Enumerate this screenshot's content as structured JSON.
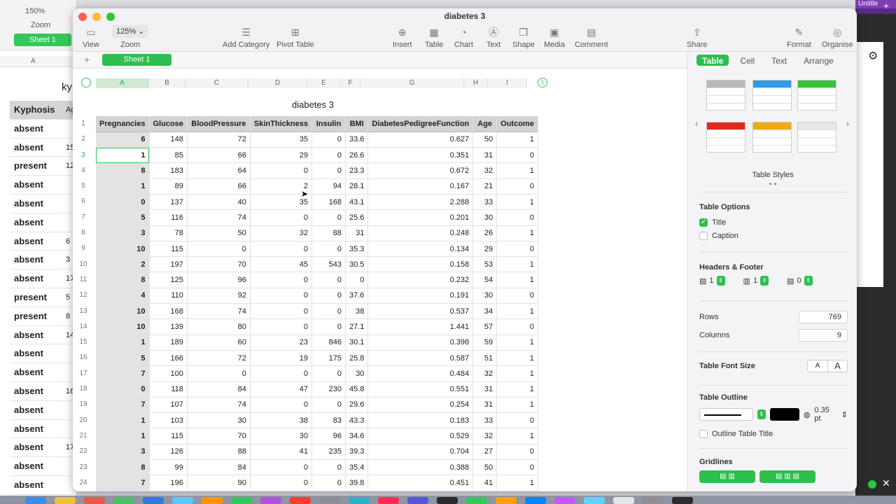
{
  "background_window": {
    "zoom": "150%",
    "zoom_label": "Zoom",
    "sheet_tab": "Sheet 1",
    "col_letter": "A",
    "title_fragment": "ky",
    "rows": [
      {
        "v": "Kyphosis",
        "f": "Ag"
      },
      {
        "v": "absent",
        "f": ""
      },
      {
        "v": "absent",
        "f": "15"
      },
      {
        "v": "present",
        "f": "12"
      },
      {
        "v": "absent",
        "f": ""
      },
      {
        "v": "absent",
        "f": ""
      },
      {
        "v": "absent",
        "f": ""
      },
      {
        "v": "absent",
        "f": "6"
      },
      {
        "v": "absent",
        "f": "3"
      },
      {
        "v": "absent",
        "f": "17"
      },
      {
        "v": "present",
        "f": "5"
      },
      {
        "v": "present",
        "f": "8"
      },
      {
        "v": "absent",
        "f": "14"
      },
      {
        "v": "absent",
        "f": ""
      },
      {
        "v": "absent",
        "f": ""
      },
      {
        "v": "absent",
        "f": "16"
      },
      {
        "v": "absent",
        "f": ""
      },
      {
        "v": "absent",
        "f": ""
      },
      {
        "v": "absent",
        "f": "17"
      },
      {
        "v": "absent",
        "f": ""
      },
      {
        "v": "absent",
        "f": ""
      }
    ]
  },
  "right_strip": {
    "tab_title": "Untitle"
  },
  "window": {
    "title": "diabetes 3"
  },
  "toolbar": {
    "view": "View",
    "zoom_value": "125%",
    "zoom": "Zoom",
    "add_category": "Add Category",
    "pivot_table": "Pivot Table",
    "insert": "Insert",
    "table": "Table",
    "chart": "Chart",
    "text": "Text",
    "shape": "Shape",
    "media": "Media",
    "comment": "Comment",
    "share": "Share",
    "format": "Format",
    "organise": "Organise"
  },
  "sheet_tab": "Sheet 1",
  "column_letters": [
    "A",
    "B",
    "C",
    "D",
    "E",
    "F",
    "G",
    "H",
    "I"
  ],
  "table": {
    "title": "diabetes 3",
    "headers": [
      "Pregnancies",
      "Glucose",
      "BloodPressure",
      "SkinThickness",
      "Insulin",
      "BMI",
      "DiabetesPedigreeFunction",
      "Age",
      "Outcome"
    ],
    "row_numbers": [
      "1",
      "2",
      "3",
      "4",
      "5",
      "6",
      "7",
      "8",
      "9",
      "10",
      "11",
      "12",
      "13",
      "14",
      "15",
      "16",
      "17",
      "18",
      "19",
      "20",
      "21",
      "22",
      "23",
      "24"
    ],
    "rows": [
      [
        "6",
        "148",
        "72",
        "35",
        "0",
        "33.6",
        "0.627",
        "50",
        "1"
      ],
      [
        "1",
        "85",
        "66",
        "29",
        "0",
        "26.6",
        "0.351",
        "31",
        "0"
      ],
      [
        "8",
        "183",
        "64",
        "0",
        "0",
        "23.3",
        "0.672",
        "32",
        "1"
      ],
      [
        "1",
        "89",
        "66",
        "2",
        "94",
        "28.1",
        "0.167",
        "21",
        "0"
      ],
      [
        "0",
        "137",
        "40",
        "35",
        "168",
        "43.1",
        "2.288",
        "33",
        "1"
      ],
      [
        "5",
        "116",
        "74",
        "0",
        "0",
        "25.6",
        "0.201",
        "30",
        "0"
      ],
      [
        "3",
        "78",
        "50",
        "32",
        "88",
        "31",
        "0.248",
        "26",
        "1"
      ],
      [
        "10",
        "115",
        "0",
        "0",
        "0",
        "35.3",
        "0.134",
        "29",
        "0"
      ],
      [
        "2",
        "197",
        "70",
        "45",
        "543",
        "30.5",
        "0.158",
        "53",
        "1"
      ],
      [
        "8",
        "125",
        "96",
        "0",
        "0",
        "0",
        "0.232",
        "54",
        "1"
      ],
      [
        "4",
        "110",
        "92",
        "0",
        "0",
        "37.6",
        "0.191",
        "30",
        "0"
      ],
      [
        "10",
        "168",
        "74",
        "0",
        "0",
        "38",
        "0.537",
        "34",
        "1"
      ],
      [
        "10",
        "139",
        "80",
        "0",
        "0",
        "27.1",
        "1.441",
        "57",
        "0"
      ],
      [
        "1",
        "189",
        "60",
        "23",
        "846",
        "30.1",
        "0.398",
        "59",
        "1"
      ],
      [
        "5",
        "166",
        "72",
        "19",
        "175",
        "25.8",
        "0.587",
        "51",
        "1"
      ],
      [
        "7",
        "100",
        "0",
        "0",
        "0",
        "30",
        "0.484",
        "32",
        "1"
      ],
      [
        "0",
        "118",
        "84",
        "47",
        "230",
        "45.8",
        "0.551",
        "31",
        "1"
      ],
      [
        "7",
        "107",
        "74",
        "0",
        "0",
        "29.6",
        "0.254",
        "31",
        "1"
      ],
      [
        "1",
        "103",
        "30",
        "38",
        "83",
        "43.3",
        "0.183",
        "33",
        "0"
      ],
      [
        "1",
        "115",
        "70",
        "30",
        "96",
        "34.6",
        "0.529",
        "32",
        "1"
      ],
      [
        "3",
        "126",
        "88",
        "41",
        "235",
        "39.3",
        "0.704",
        "27",
        "0"
      ],
      [
        "8",
        "99",
        "84",
        "0",
        "0",
        "35.4",
        "0.388",
        "50",
        "0"
      ],
      [
        "7",
        "196",
        "90",
        "0",
        "0",
        "39.8",
        "0.451",
        "41",
        "1"
      ]
    ]
  },
  "inspector": {
    "tabs": [
      "Table",
      "Cell",
      "Text",
      "Arrange"
    ],
    "table_styles": "Table Styles",
    "table_options": "Table Options",
    "title_option": "Title",
    "caption_option": "Caption",
    "headers_footer": "Headers & Footer",
    "header_rows": "1",
    "header_cols": "1",
    "footer_rows": "0",
    "rows_label": "Rows",
    "rows_value": "769",
    "columns_label": "Columns",
    "columns_value": "9",
    "font_size_label": "Table Font Size",
    "font_small": "A",
    "font_big": "A",
    "outline_label": "Table Outline",
    "outline_width": "0.35 pt",
    "outline_title": "Outline Table Title",
    "gridlines": "Gridlines",
    "style_colors": [
      "#b9b9b9",
      "#2f9be8",
      "#38c23a",
      "#e0281f",
      "#efaa16",
      "#e8e8e8"
    ]
  }
}
